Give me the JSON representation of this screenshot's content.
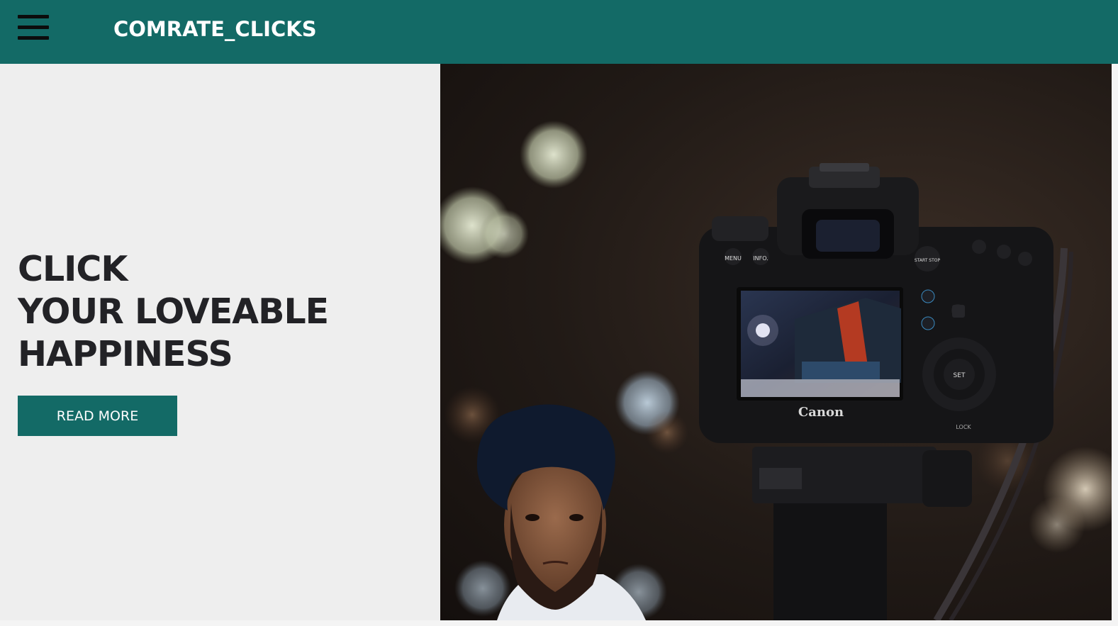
{
  "navbar": {
    "brand": "COMRATE_CLICKS",
    "menu_icon": "hamburger-menu-icon"
  },
  "hero": {
    "headline_lines": [
      "CLICK",
      "YOUR LOVEABLE",
      "HAPPINESS"
    ],
    "button_label": "READ MORE",
    "camera_brand": "Canon",
    "camera_labels": {
      "menu": "MENU",
      "info": "INFO.",
      "start_stop": "START STOP",
      "set": "SET",
      "lock": "LOCK"
    }
  },
  "colors": {
    "primary": "#136a66",
    "headline": "#222226",
    "panel_bg": "#eeeeee"
  }
}
